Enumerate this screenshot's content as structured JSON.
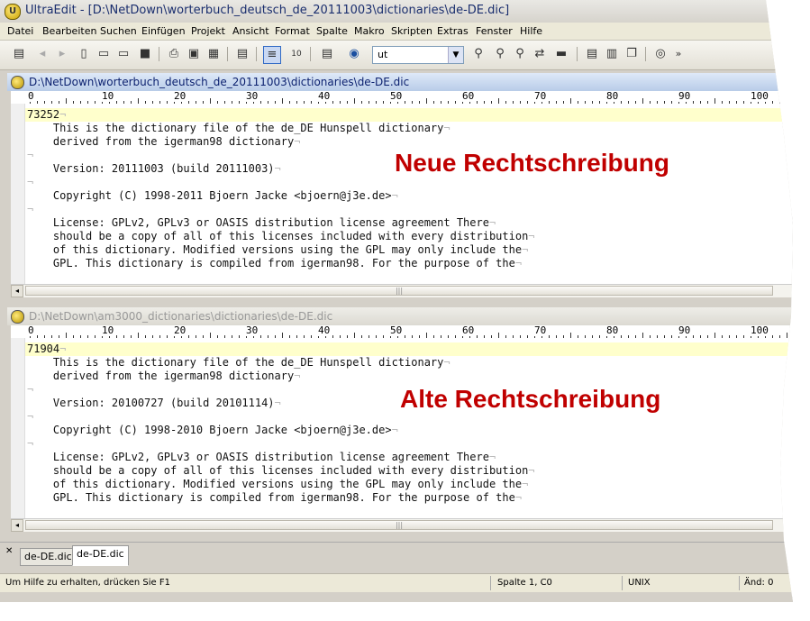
{
  "window": {
    "title": "UltraEdit - [D:\\NetDown\\worterbuch_deutsch_de_20111003\\dictionaries\\de-DE.dic]"
  },
  "menu": [
    "Datei",
    "Bearbeiten",
    "Suchen",
    "Einfügen",
    "Projekt",
    "Ansicht",
    "Format",
    "Spalte",
    "Makro",
    "Skripten",
    "Extras",
    "Fenster",
    "Hilfe"
  ],
  "toolbar": {
    "search_combo_value": "ut",
    "chevron": "»"
  },
  "ruler": {
    "labels": [
      "0",
      "10",
      "20",
      "30",
      "40",
      "50",
      "60",
      "70",
      "80",
      "90",
      "100"
    ]
  },
  "pane_top": {
    "path": "D:\\NetDown\\worterbuch_deutsch_de_20111003\\dictionaries\\de-DE.dic",
    "lines": [
      "73252",
      "    This is the dictionary file of the de_DE Hunspell dictionary",
      "    derived from the igerman98 dictionary",
      "",
      "    Version: 20111003 (build 20111003)",
      "",
      "    Copyright (C) 1998-2011 Bjoern Jacke <bjoern@j3e.de>",
      "",
      "    License: GPLv2, GPLv3 or OASIS distribution license agreement There",
      "    should be a copy of all of this licenses included with every distribution",
      "    of this dictionary. Modified versions using the GPL may only include the",
      "    GPL. This dictionary is compiled from igerman98. For the purpose of the"
    ],
    "label": "Neue Rechtschreibung"
  },
  "pane_bottom": {
    "path": "D:\\NetDown\\am3000_dictionaries\\dictionaries\\de-DE.dic",
    "lines": [
      "71904",
      "    This is the dictionary file of the de_DE Hunspell dictionary",
      "    derived from the igerman98 dictionary",
      "",
      "    Version: 20100727 (build 20101114)",
      "",
      "    Copyright (C) 1998-2010 Bjoern Jacke <bjoern@j3e.de>",
      "",
      "    License: GPLv2, GPLv3 or OASIS distribution license agreement There",
      "    should be a copy of all of this licenses included with every distribution",
      "    of this dictionary. Modified versions using the GPL may only include the",
      "    GPL. This dictionary is compiled from igerman98. For the purpose of the"
    ],
    "label": "Alte Rechtschreibung"
  },
  "tabs": [
    "de-DE.dic",
    "de-DE.dic"
  ],
  "statusbar": {
    "help": "Um Hilfe zu erhalten, drücken Sie F1",
    "position": "Spalte 1, C0",
    "format": "UNIX",
    "modified": "Änd: 0"
  },
  "colors": {
    "label_red": "#c00000",
    "active_title": "#0a1f6e"
  }
}
